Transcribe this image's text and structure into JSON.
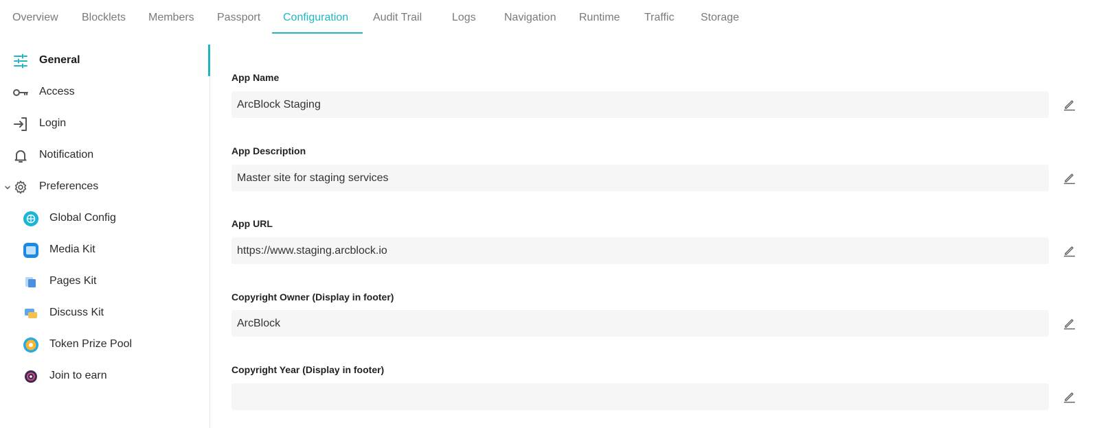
{
  "tabs": [
    {
      "label": "Overview"
    },
    {
      "label": "Blocklets"
    },
    {
      "label": "Members"
    },
    {
      "label": "Passport"
    },
    {
      "label": "Configuration",
      "active": true
    },
    {
      "label": "Audit Trail"
    },
    {
      "label": "Logs"
    },
    {
      "label": "Navigation"
    },
    {
      "label": "Runtime"
    },
    {
      "label": "Traffic"
    },
    {
      "label": "Storage"
    }
  ],
  "sidebar": {
    "items": [
      {
        "label": "General",
        "icon": "sliders-icon",
        "active": true
      },
      {
        "label": "Access",
        "icon": "key-icon"
      },
      {
        "label": "Login",
        "icon": "login-icon"
      },
      {
        "label": "Notification",
        "icon": "bell-icon"
      },
      {
        "label": "Preferences",
        "icon": "gear-icon",
        "expanded": true
      }
    ],
    "sub_items": [
      {
        "label": "Global Config",
        "icon": "global-config-icon"
      },
      {
        "label": "Media Kit",
        "icon": "media-kit-icon"
      },
      {
        "label": "Pages Kit",
        "icon": "pages-kit-icon"
      },
      {
        "label": "Discuss Kit",
        "icon": "discuss-kit-icon"
      },
      {
        "label": "Token Prize Pool",
        "icon": "token-prize-pool-icon"
      },
      {
        "label": "Join to earn",
        "icon": "join-to-earn-icon"
      }
    ]
  },
  "form": {
    "fields": [
      {
        "label": "App Name",
        "value": "ArcBlock Staging"
      },
      {
        "label": "App Description",
        "value": "Master site for staging services"
      },
      {
        "label": "App URL",
        "value": "https://www.staging.arcblock.io"
      },
      {
        "label": "Copyright Owner (Display in footer)",
        "value": "ArcBlock"
      },
      {
        "label": "Copyright Year (Display in footer)",
        "value": ""
      }
    ]
  },
  "colors": {
    "accent": "#1fb6c4",
    "field_bg": "#f6f6f6",
    "tab_inactive": "#7a7a7a"
  }
}
